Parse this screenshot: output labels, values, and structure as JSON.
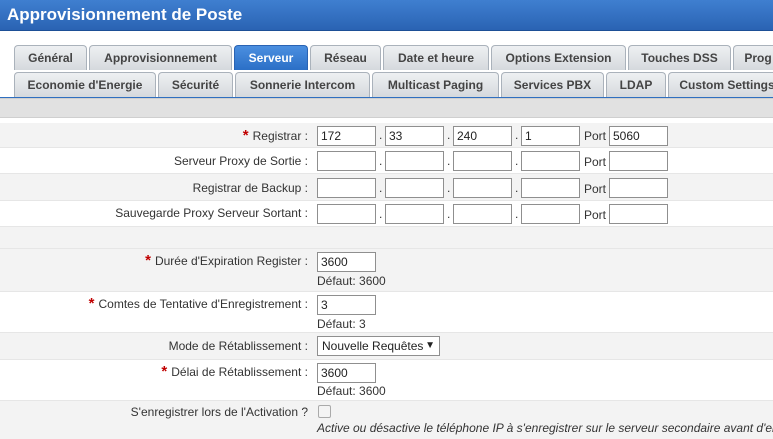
{
  "title": "Approvisionnement de Poste",
  "tabs_row1": [
    "Général",
    "Approvisionnement",
    "Serveur",
    "Réseau",
    "Date et heure",
    "Options Extension",
    "Touches DSS",
    "Prog"
  ],
  "tabs_row2": [
    "Economie d'Energie",
    "Sécurité",
    "Sonnerie Intercom",
    "Multicast Paging",
    "Services PBX",
    "LDAP",
    "Custom Settings"
  ],
  "active_tab": "Serveur",
  "form": {
    "port_label": "Port",
    "registrar": {
      "label": "Registrar",
      "ip": [
        "172",
        "33",
        "240",
        "1"
      ],
      "port": "5060"
    },
    "outbound_proxy": {
      "label": "Serveur Proxy de Sortie",
      "ip": [
        "",
        "",
        "",
        ""
      ],
      "port": ""
    },
    "backup_registrar": {
      "label": "Registrar de Backup",
      "ip": [
        "",
        "",
        "",
        ""
      ],
      "port": ""
    },
    "backup_outbound_proxy": {
      "label": "Sauvegarde Proxy Serveur Sortant",
      "ip": [
        "",
        "",
        "",
        ""
      ],
      "port": ""
    },
    "register_expiration": {
      "label": "Durée d'Expiration Register",
      "value": "3600",
      "default": "Défaut: 3600"
    },
    "register_retry_count": {
      "label": "Comtes de Tentative d'Enregistrement",
      "value": "3",
      "default": "Défaut: 3"
    },
    "recovery_mode": {
      "label": "Mode de Rétablissement",
      "value": "Nouvelle Requêtes"
    },
    "recovery_delay": {
      "label": "Délai de Rétablissement",
      "value": "3600",
      "default": "Défaut: 3600"
    },
    "register_on_activation": {
      "label": "S'enregistrer lors de l'Activation ?",
      "checked": false,
      "note": "Active ou désactive le téléphone IP à s'enregistrer sur le serveur secondaire avant d'envoyer"
    }
  }
}
